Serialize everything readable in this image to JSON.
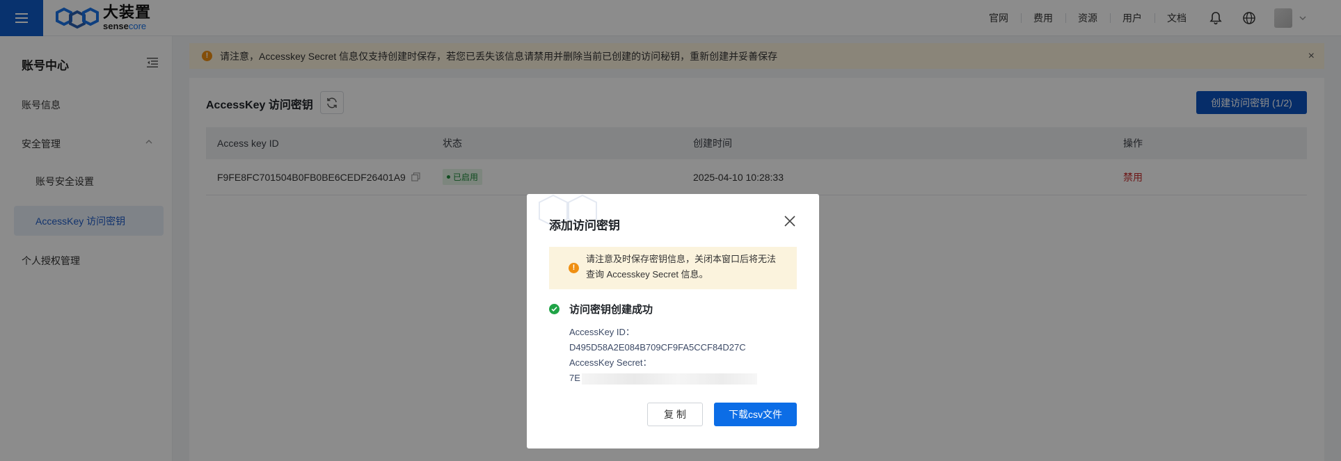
{
  "topbar": {
    "logo_cn": "大装置",
    "logo_en_a": "sense",
    "logo_en_b": "core",
    "nav": [
      "官网",
      "费用",
      "资源",
      "用户",
      "文档"
    ]
  },
  "sidebar": {
    "title": "账号中心",
    "items": {
      "account_info": "账号信息",
      "security": "安全管理",
      "security_settings": "账号安全设置",
      "accesskey": "AccessKey 访问密钥",
      "personal_auth": "个人授权管理"
    }
  },
  "banner": {
    "text": "请注意，Accesskey Secret 信息仅支持创建时保存，若您已丢失该信息请禁用并删除当前已创建的访问秘钥，重新创建并妥善保存",
    "close": "×"
  },
  "card": {
    "title": "AccessKey 访问密钥",
    "create_label": "创建访问密钥 (1/2)"
  },
  "table": {
    "headers": [
      "Access key ID",
      "状态",
      "创建时间",
      "操作"
    ],
    "rows": [
      {
        "id": "F9FE8FC701504B0FB0BE6CEDF26401A9",
        "status": "已启用",
        "created": "2025-04-10 10:28:33",
        "action": "禁用"
      }
    ]
  },
  "modal": {
    "title": "添加访问密钥",
    "warning": "请注意及时保存密钥信息，关闭本窗口后将无法查询 Accesskey Secret 信息。",
    "success": "访问密钥创建成功",
    "id_label": "AccessKey ID：",
    "id_value": "D495D58A2E084B709CF9FA5CCF84D27C",
    "secret_label": "AccessKey Secret：",
    "secret_prefix": "7E",
    "copy_label": "复 制",
    "download_label": "下载csv文件"
  },
  "colors": {
    "brand": "#0c53bf",
    "primary_button": "#0c6de6",
    "warning": "#ef8f12",
    "success": "#1fa346",
    "danger": "#c72c2c"
  },
  "icons": [
    "menu-icon",
    "bell-icon",
    "globe-icon",
    "chevron-down-icon",
    "collapse-menu-icon",
    "chevron-up-icon",
    "warning-icon",
    "close-icon",
    "refresh-icon",
    "copy-icon",
    "check-circle-icon"
  ]
}
